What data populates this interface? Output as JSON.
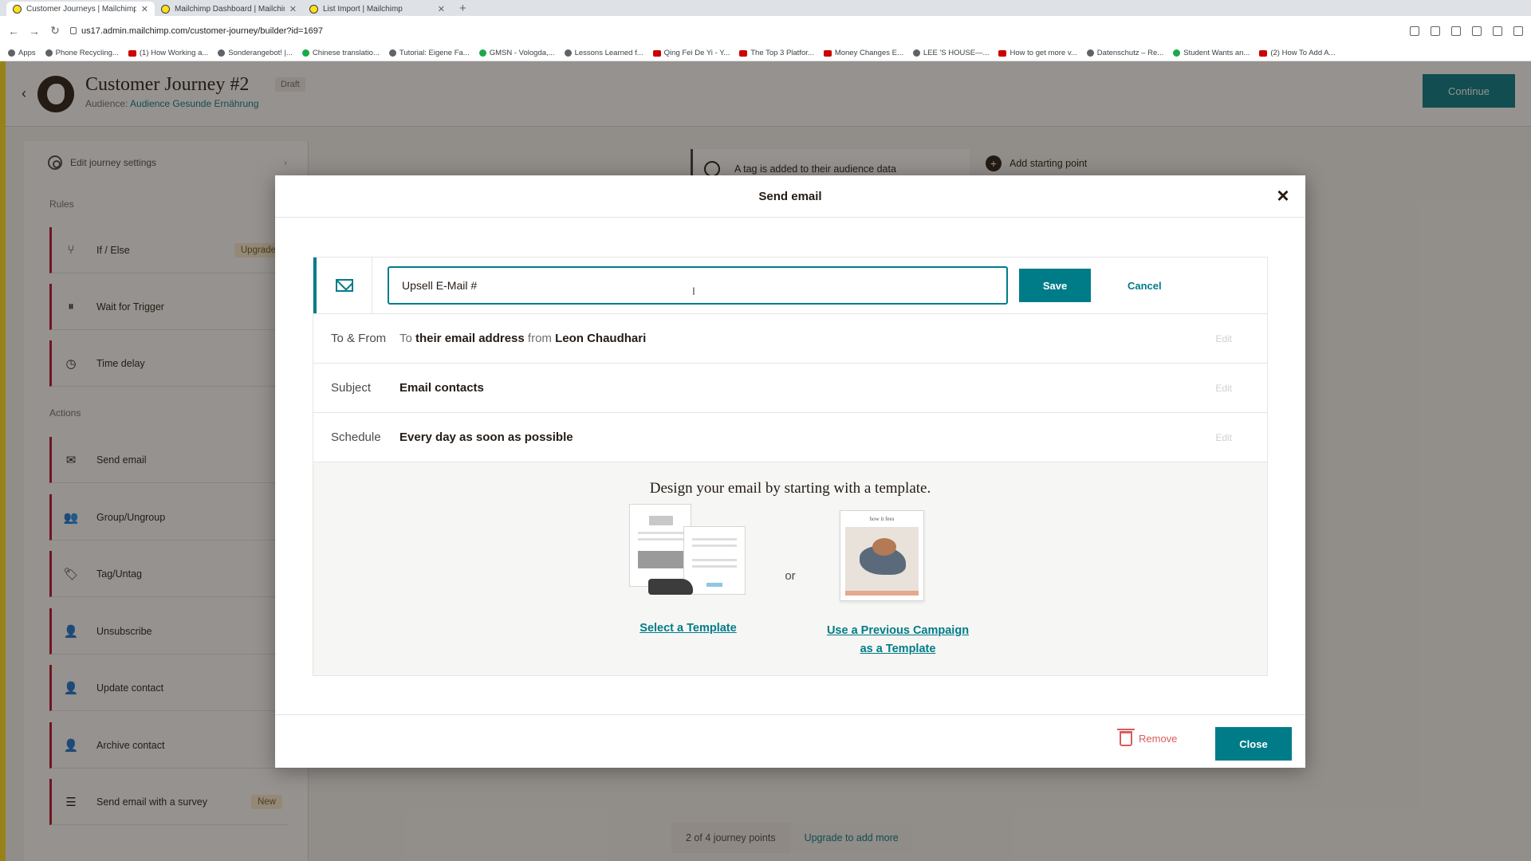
{
  "browser": {
    "tabs": [
      {
        "label": "Customer Journeys | Mailchimp",
        "active": true
      },
      {
        "label": "Mailchimp Dashboard | Mailchimp",
        "active": false
      },
      {
        "label": "List Import | Mailchimp",
        "active": false
      }
    ],
    "new_tab": "+",
    "url": "us17.admin.mailchimp.com/customer-journey/builder?id=1697",
    "bookmarks": [
      "Apps",
      "Phone Recycling...",
      "(1) How Working a...",
      "Sonderangebot! |...",
      "Chinese translatio...",
      "Tutorial: Eigene Fa...",
      "GMSN - Vologda,...",
      "Lessons Learned f...",
      "Qing Fei De Yi - Y...",
      "The Top 3 Platfor...",
      "Money Changes E...",
      "LEE 'S HOUSE—...",
      "How to get more v...",
      "Datenschutz – Re...",
      "Student Wants an...",
      "(2) How To Add A..."
    ]
  },
  "header": {
    "title": "Customer Journey #2",
    "status": "Draft",
    "audience_label": "Audience:",
    "audience_name": "Audience Gesunde Ernährung",
    "continue_label": "Continue"
  },
  "sidebar": {
    "settings_label": "Edit journey settings",
    "rules_heading": "Rules",
    "rules": [
      {
        "label": "If / Else",
        "icon": "branch-icon",
        "badge": "Upgrade"
      },
      {
        "label": "Wait for Trigger",
        "icon": "pause-icon",
        "badge": ""
      },
      {
        "label": "Time delay",
        "icon": "clock-icon",
        "badge": ""
      }
    ],
    "actions_heading": "Actions",
    "actions": [
      {
        "label": "Send email",
        "icon": "envelope-icon",
        "badge": ""
      },
      {
        "label": "Group/Ungroup",
        "icon": "group-icon",
        "badge": ""
      },
      {
        "label": "Tag/Untag",
        "icon": "tag-icon",
        "badge": ""
      },
      {
        "label": "Unsubscribe",
        "icon": "person-icon",
        "badge": ""
      },
      {
        "label": "Update contact",
        "icon": "person-edit-icon",
        "badge": ""
      },
      {
        "label": "Archive contact",
        "icon": "person-icon",
        "badge": ""
      },
      {
        "label": "Send email with a survey",
        "icon": "survey-icon",
        "badge": "New"
      }
    ]
  },
  "canvas": {
    "trigger_text": "A tag is added to their audience data",
    "add_starting_point": "Add starting point",
    "journey_points": "2 of 4 journey points",
    "upgrade_link": "Upgrade to add more"
  },
  "modal": {
    "title": "Send email",
    "email_name_value": "Upsell E-Mail #",
    "save_label": "Save",
    "cancel_label": "Cancel",
    "to_from": {
      "label": "To & From",
      "to_word": "To",
      "recipient": "their email address",
      "from_word": "from",
      "sender": "Leon Chaudhari",
      "edit": "Edit"
    },
    "subject": {
      "label": "Subject",
      "value": "Email contacts",
      "edit": "Edit"
    },
    "schedule": {
      "label": "Schedule",
      "value": "Every day as soon as possible",
      "edit": "Edit"
    },
    "design_heading": "Design your email by starting with a template.",
    "or_text": "or",
    "select_template": "Select a Template",
    "use_previous_line1": "Use a Previous Campaign",
    "use_previous_line2": "as a Template",
    "campaign_preview_header": "how it fees",
    "remove_label": "Remove",
    "close_label": "Close"
  },
  "colors": {
    "accent": "#007c89",
    "brand_yellow": "#ffe01b",
    "danger": "#d95c5c"
  }
}
